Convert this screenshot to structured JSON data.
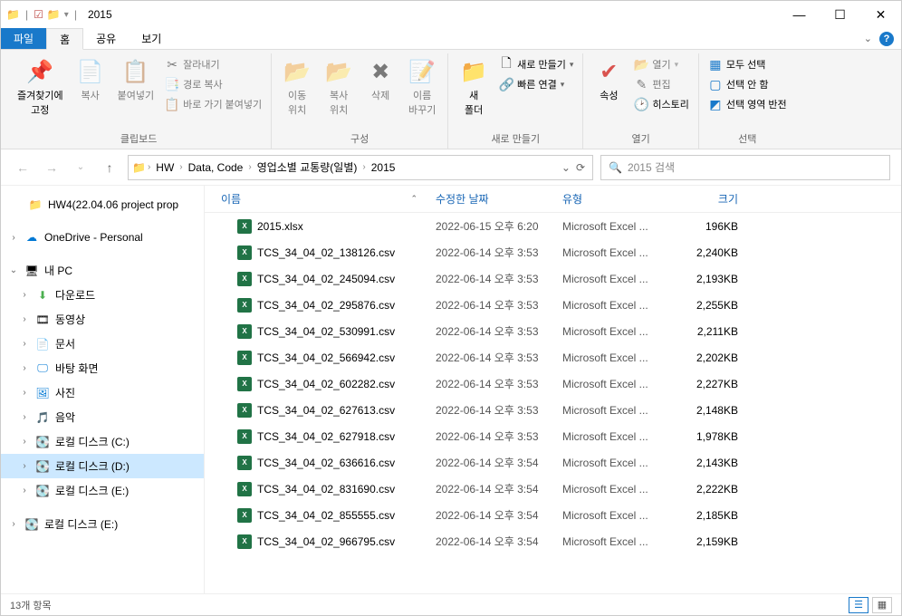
{
  "window": {
    "title": "2015"
  },
  "tabs": {
    "file": "파일",
    "home": "홈",
    "share": "공유",
    "view": "보기"
  },
  "ribbon": {
    "clipboard": {
      "label": "클립보드",
      "pin": "즐겨찾기에\n고정",
      "copy": "복사",
      "paste": "붙여넣기",
      "cut": "잘라내기",
      "copypath": "경로 복사",
      "pasteshortcut": "바로 가기 붙여넣기"
    },
    "organize": {
      "label": "구성",
      "moveto": "이동\n위치",
      "copyto": "복사\n위치",
      "delete": "삭제",
      "rename": "이름\n바꾸기"
    },
    "new": {
      "label": "새로 만들기",
      "newfolder": "새\n폴더",
      "newitem": "새로 만들기",
      "easyaccess": "빠른 연결"
    },
    "open": {
      "label": "열기",
      "properties": "속성",
      "open": "열기",
      "edit": "편집",
      "history": "히스토리"
    },
    "select": {
      "label": "선택",
      "all": "모두 선택",
      "none": "선택 안 함",
      "invert": "선택 영역 반전"
    }
  },
  "breadcrumb": [
    "HW",
    "Data, Code",
    "영업소별 교통량(일별)",
    "2015"
  ],
  "search": {
    "placeholder": "2015 검색"
  },
  "columns": {
    "name": "이름",
    "date": "수정한 날짜",
    "type": "유형",
    "size": "크기"
  },
  "nav": {
    "hw4": "HW4(22.04.06 project prop",
    "onedrive": "OneDrive - Personal",
    "thispc": "내 PC",
    "downloads": "다운로드",
    "videos": "동영상",
    "documents": "문서",
    "desktop": "바탕 화면",
    "pictures": "사진",
    "music": "음악",
    "diskc": "로컬 디스크 (C:)",
    "diskd": "로컬 디스크 (D:)",
    "diske1": "로컬 디스크 (E:)",
    "diske2": "로컬 디스크 (E:)"
  },
  "files": [
    {
      "name": "2015.xlsx",
      "date": "2022-06-15 오후 6:20",
      "type": "Microsoft Excel ...",
      "size": "196KB"
    },
    {
      "name": "TCS_34_04_02_138126.csv",
      "date": "2022-06-14 오후 3:53",
      "type": "Microsoft Excel ...",
      "size": "2,240KB"
    },
    {
      "name": "TCS_34_04_02_245094.csv",
      "date": "2022-06-14 오후 3:53",
      "type": "Microsoft Excel ...",
      "size": "2,193KB"
    },
    {
      "name": "TCS_34_04_02_295876.csv",
      "date": "2022-06-14 오후 3:53",
      "type": "Microsoft Excel ...",
      "size": "2,255KB"
    },
    {
      "name": "TCS_34_04_02_530991.csv",
      "date": "2022-06-14 오후 3:53",
      "type": "Microsoft Excel ...",
      "size": "2,211KB"
    },
    {
      "name": "TCS_34_04_02_566942.csv",
      "date": "2022-06-14 오후 3:53",
      "type": "Microsoft Excel ...",
      "size": "2,202KB"
    },
    {
      "name": "TCS_34_04_02_602282.csv",
      "date": "2022-06-14 오후 3:53",
      "type": "Microsoft Excel ...",
      "size": "2,227KB"
    },
    {
      "name": "TCS_34_04_02_627613.csv",
      "date": "2022-06-14 오후 3:53",
      "type": "Microsoft Excel ...",
      "size": "2,148KB"
    },
    {
      "name": "TCS_34_04_02_627918.csv",
      "date": "2022-06-14 오후 3:53",
      "type": "Microsoft Excel ...",
      "size": "1,978KB"
    },
    {
      "name": "TCS_34_04_02_636616.csv",
      "date": "2022-06-14 오후 3:54",
      "type": "Microsoft Excel ...",
      "size": "2,143KB"
    },
    {
      "name": "TCS_34_04_02_831690.csv",
      "date": "2022-06-14 오후 3:54",
      "type": "Microsoft Excel ...",
      "size": "2,222KB"
    },
    {
      "name": "TCS_34_04_02_855555.csv",
      "date": "2022-06-14 오후 3:54",
      "type": "Microsoft Excel ...",
      "size": "2,185KB"
    },
    {
      "name": "TCS_34_04_02_966795.csv",
      "date": "2022-06-14 오후 3:54",
      "type": "Microsoft Excel ...",
      "size": "2,159KB"
    }
  ],
  "status": {
    "count": "13개 항목"
  }
}
